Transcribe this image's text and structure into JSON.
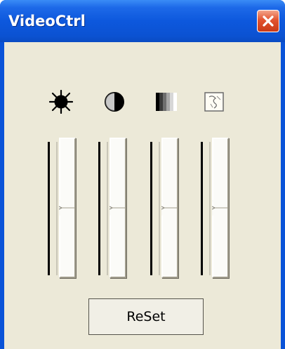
{
  "window": {
    "title": "VideoCtrl"
  },
  "controls": [
    {
      "icon": "brightness-icon",
      "level": 0.5
    },
    {
      "icon": "contrast-icon",
      "level": 0.5
    },
    {
      "icon": "saturation-icon",
      "level": 0.5
    },
    {
      "icon": "hue-icon",
      "level": 0.5
    }
  ],
  "buttons": {
    "reset_label": "ReSet"
  },
  "colors": {
    "titlebar": "#0a53d8",
    "client_background": "#ece9d8",
    "close_button": "#e2532f"
  }
}
